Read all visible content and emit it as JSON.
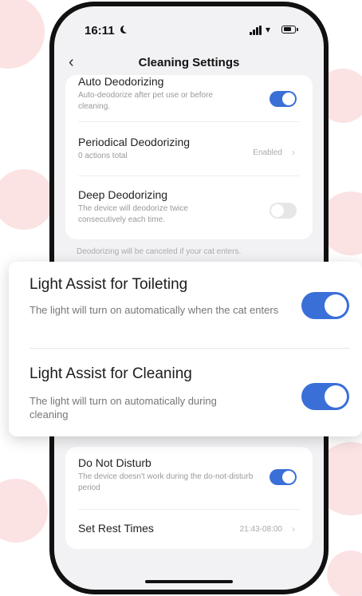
{
  "status_bar": {
    "time": "16:11"
  },
  "nav": {
    "title": "Cleaning Settings"
  },
  "colors": {
    "accent": "#3a6fd8",
    "background_mark": "#fbe3e3"
  },
  "card1": {
    "items": [
      {
        "title": "Auto Deodorizing",
        "subtitle": "Auto-deodorize after pet use or before cleaning.",
        "toggle": "on"
      },
      {
        "title": "Periodical Deodorizing",
        "subtitle": "0 actions total",
        "value": "Enabled"
      },
      {
        "title": "Deep Deodorizing",
        "subtitle": "The device will deodorize twice consecutively each time.",
        "toggle": "off"
      }
    ],
    "note": "Deodorizing will be canceled if your cat enters."
  },
  "card2": {
    "items": [
      {
        "title": "Do Not Disturb",
        "subtitle": "The device doesn't work during the do-not-disturb period",
        "toggle": "on"
      },
      {
        "title": "Set Rest Times",
        "value": "21:43-08:00"
      }
    ]
  },
  "overlay": {
    "items": [
      {
        "title": "Light Assist for Toileting",
        "subtitle": "The light will turn on automatically when the cat enters",
        "toggle": "on"
      },
      {
        "title": "Light Assist for Cleaning",
        "subtitle": "The light will turn on automatically during cleaning",
        "toggle": "on"
      }
    ]
  },
  "icons": [
    "moon-icon",
    "signal-icon",
    "wifi-icon",
    "battery-icon",
    "back-chevron-icon",
    "chevron-right-icon"
  ]
}
